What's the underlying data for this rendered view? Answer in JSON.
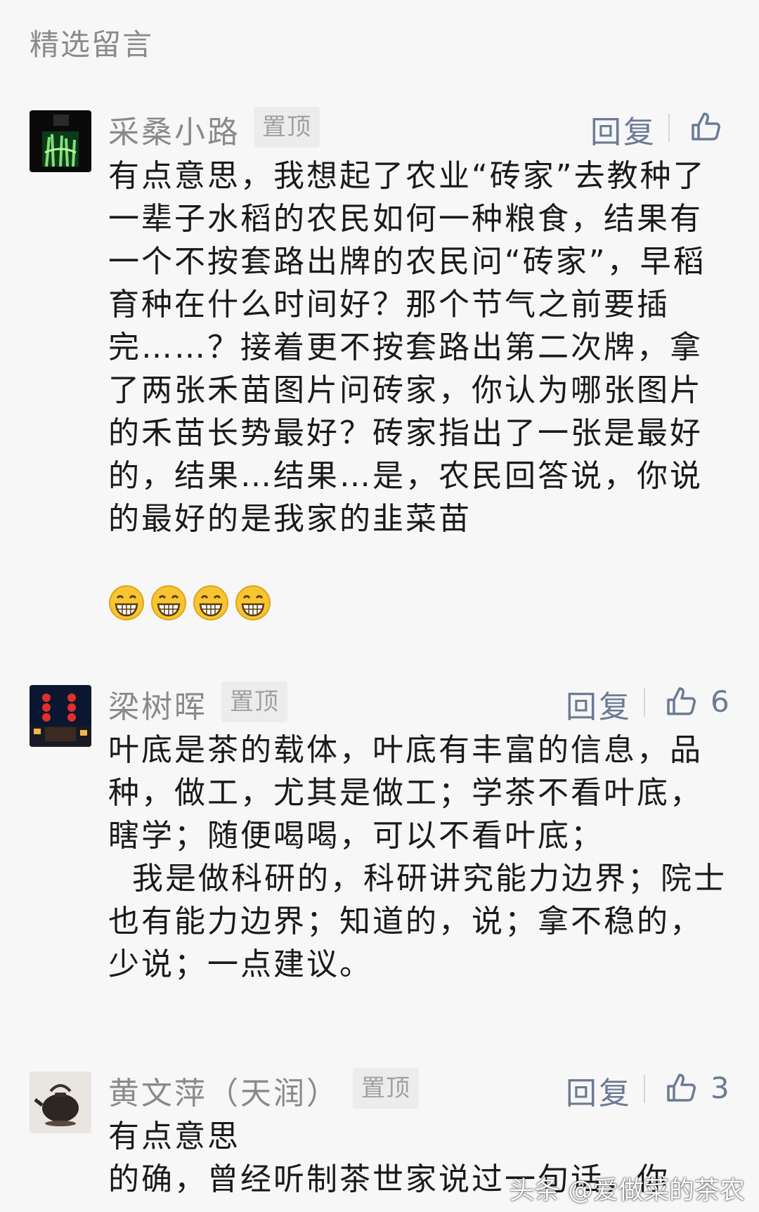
{
  "section": {
    "title": "精选留言"
  },
  "labels": {
    "pinned": "置顶",
    "reply": "回复"
  },
  "colors": {
    "accent": "#6b7a96",
    "muted": "#8a8a8a",
    "pin_bg": "#ececec"
  },
  "comments": [
    {
      "author": "采桑小路",
      "pinned": true,
      "likes": "",
      "text": "有点意思，我想起了农业“砖家”去教种了一辈子水稻的农民如何一种粮食，结果有一个不按套路出牌的农民问“砖家”，早稻育种在什么时间好？那个节气之前要插完……？接着更不按套路出第二次牌，拿了两张禾苗图片问砖家，你认为哪张图片的禾苗长势最好？砖家指出了一张是最好的，结果…结果…是，农民回答说，你说的最好的是我家的韭菜苗",
      "emoji": [
        "grin-icon",
        "grin-icon",
        "grin-icon",
        "grin-icon"
      ]
    },
    {
      "author": "梁树晖",
      "pinned": true,
      "likes": "6",
      "text": "叶底是茶的载体，叶底有丰富的信息，品种，做工，尤其是做工；学茶不看叶底，瞎学；随便喝喝，可以不看叶底；\n  我是做科研的，科研讲究能力边界；院士也有能力边界；知道的，说；拿不稳的，少说；一点建议。"
    },
    {
      "author": "黄文萍（天润）",
      "pinned": true,
      "likes": "3",
      "text": "有点意思\n的确，曾经听制茶世家说过一句话，你"
    }
  ],
  "watermark": "头条 @爱做菜的茶农"
}
